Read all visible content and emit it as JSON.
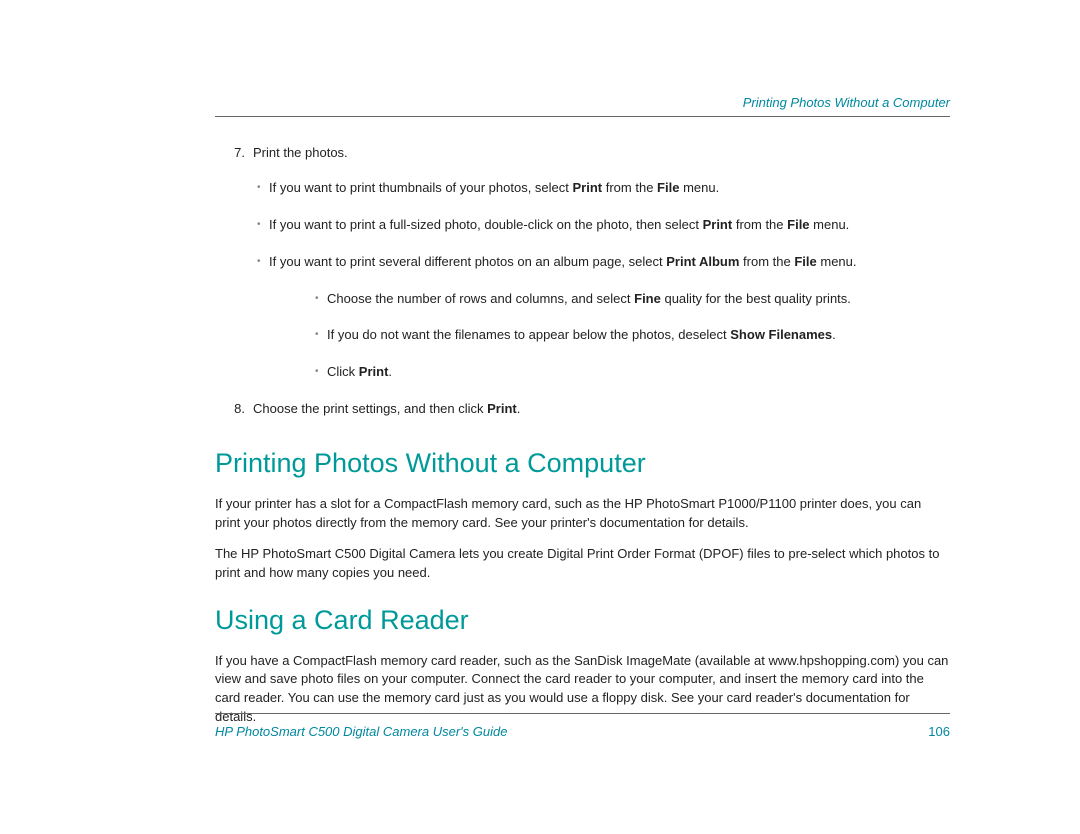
{
  "header": {
    "section": "Printing Photos Without a Computer"
  },
  "step7": {
    "num": "7.",
    "text": "Print the photos.",
    "b1_a": "If you want to print thumbnails of your photos, select ",
    "b1_b": "Print",
    "b1_c": " from the ",
    "b1_d": "File",
    "b1_e": " menu.",
    "b2_a": "If you want to print a full-sized photo, double-click on the photo, then select ",
    "b2_b": "Print",
    "b2_c": " from the ",
    "b2_d": "File",
    "b2_e": " menu.",
    "b3_a": "If you want to print several different photos on an album page, select ",
    "b3_b": "Print Album",
    "b3_c": " from the ",
    "b3_d": "File",
    "b3_e": " menu.",
    "sb1_a": "Choose the number of rows and columns, and select ",
    "sb1_b": "Fine",
    "sb1_c": " quality for the best quality prints.",
    "sb2_a": "If you do not want the filenames to appear below the photos, deselect ",
    "sb2_b": "Show Filenames",
    "sb2_c": ".",
    "sb3_a": "Click ",
    "sb3_b": "Print",
    "sb3_c": "."
  },
  "step8": {
    "num": "8.",
    "text_a": "Choose the print settings, and then click ",
    "text_b": "Print",
    "text_c": "."
  },
  "sectionA": {
    "title": "Printing Photos Without a Computer",
    "p1": "If your printer has a slot for a CompactFlash memory card, such as the HP PhotoSmart P1000/P1100 printer does, you can print your photos directly from the memory card. See your printer's documentation for details.",
    "p2": "The HP PhotoSmart C500 Digital Camera lets you create Digital Print Order Format (DPOF) files to pre-select which photos to print and how many copies you need."
  },
  "sectionB": {
    "title": "Using a Card Reader",
    "p1": "If you have a CompactFlash memory card reader, such as the SanDisk ImageMate (available at www.hpshopping.com) you can view and save photo files on your computer. Connect the card reader to your computer, and insert the memory card into the card reader. You can use the memory card just as you would use a floppy disk. See your card reader's documentation for details."
  },
  "footer": {
    "guide": "HP PhotoSmart C500 Digital Camera User's Guide",
    "page": "106"
  }
}
